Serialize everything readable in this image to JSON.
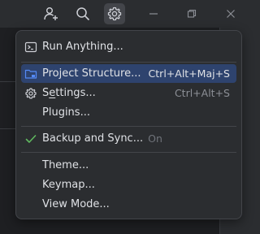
{
  "toolbar": {
    "icons": [
      "add-user-icon",
      "search-icon",
      "gear-icon"
    ],
    "window_controls": [
      "minimize-icon",
      "restore-icon",
      "close-icon"
    ]
  },
  "menu": {
    "items": [
      {
        "label": "Run Anything...",
        "icon": "run-anything-icon",
        "shortcut": ""
      },
      {
        "label": "Project Structure...",
        "icon": "project-structure-icon",
        "shortcut": "Ctrl+Alt+Maj+S"
      },
      {
        "label_pre": "S",
        "label_mnemonic": "e",
        "label_post": "ttings...",
        "icon": "gear-icon",
        "shortcut": "Ctrl+Alt+S"
      },
      {
        "label": "Plugins...",
        "icon": "",
        "shortcut": ""
      },
      {
        "label": "Backup and Sync...",
        "suffix": "On",
        "icon": "checkmark-icon",
        "shortcut": ""
      },
      {
        "label": "Theme...",
        "icon": "",
        "shortcut": ""
      },
      {
        "label": "Keymap...",
        "icon": "",
        "shortcut": ""
      },
      {
        "label": "View Mode...",
        "icon": "",
        "shortcut": ""
      }
    ]
  },
  "colors": {
    "selection": "#2e436e",
    "menu_bg": "#2b2d30",
    "check": "#5fb85f",
    "folder_icon": "#548af7"
  }
}
